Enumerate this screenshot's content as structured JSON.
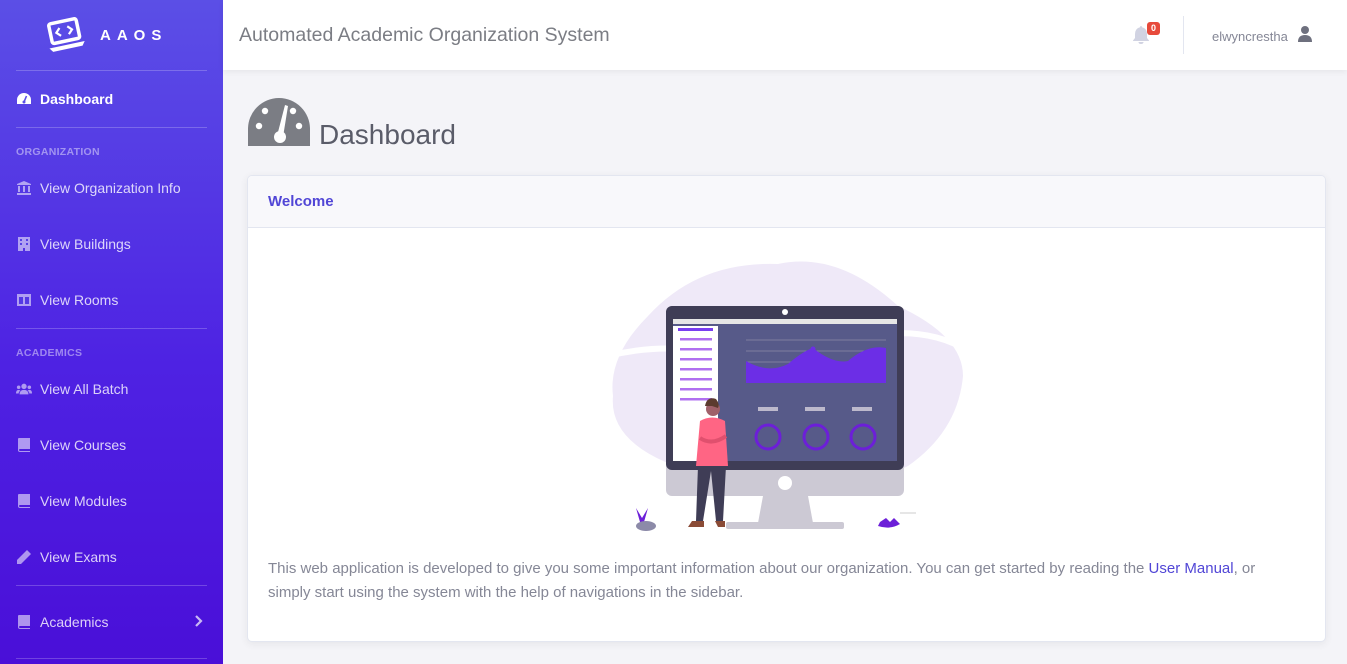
{
  "brand": {
    "name": "AAOS"
  },
  "sidebar": {
    "dashboard": {
      "label": "Dashboard",
      "icon": "tachometer-icon"
    },
    "sections": [
      {
        "heading": "ORGANIZATION",
        "items": [
          {
            "label": "View Organization Info",
            "icon": "landmark-icon"
          },
          {
            "label": "View Buildings",
            "icon": "building-icon"
          },
          {
            "label": "View Rooms",
            "icon": "columns-icon"
          }
        ]
      },
      {
        "heading": "ACADEMICS",
        "items": [
          {
            "label": "View All Batch",
            "icon": "users-icon"
          },
          {
            "label": "View Courses",
            "icon": "book-icon"
          },
          {
            "label": "View Modules",
            "icon": "book-icon"
          },
          {
            "label": "View Exams",
            "icon": "pencil-icon"
          }
        ]
      }
    ],
    "collapse": {
      "label": "Academics",
      "icon": "book-icon",
      "chevron": "chevron-right-icon"
    }
  },
  "topbar": {
    "title": "Automated Academic Organization System",
    "notification_count": "0",
    "username": "elwyncrestha"
  },
  "page": {
    "title": "Dashboard"
  },
  "welcome_card": {
    "title": "Welcome",
    "text_before": "This web application is developed to give you some important information about our organization. You can get started by reading the ",
    "link_text": "User Manual",
    "text_after": ", or simply start using the system with the help of navigations in the sidebar."
  },
  "colors": {
    "accent": "#5146d6",
    "sidebar_top": "#5b4fe6",
    "sidebar_bottom": "#4a0fd8",
    "badge": "#e74a3b"
  }
}
